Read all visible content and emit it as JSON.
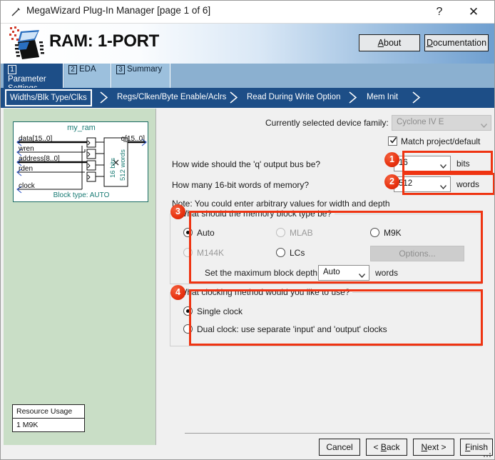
{
  "window": {
    "title": "MegaWizard Plug-In Manager [page 1 of 6]",
    "icon": "wand-icon",
    "help_label": "?",
    "close_label": "✕"
  },
  "banner": {
    "title": "RAM: 1-PORT",
    "logo": "megawizard-chip-icon",
    "buttons": [
      {
        "label": "About",
        "accel": "A",
        "rest": "bout",
        "pre": ""
      },
      {
        "label": "Documentation",
        "accel": "D",
        "rest": "ocumentation",
        "pre": ""
      }
    ]
  },
  "tabs": [
    {
      "num": "1",
      "label": "Parameter Settings",
      "active": true
    },
    {
      "num": "2",
      "label": "EDA",
      "active": false
    },
    {
      "num": "3",
      "label": "Summary",
      "active": false
    }
  ],
  "breadcrumbs": [
    {
      "label": "Widths/Blk Type/Clks",
      "active": true
    },
    {
      "label": "Regs/Clken/Byte Enable/Aclrs",
      "active": false
    },
    {
      "label": "Read During Write Option",
      "active": false
    },
    {
      "label": "Mem Init",
      "active": false
    }
  ],
  "preview": {
    "module_name": "my_ram",
    "inputs": [
      "data[15..0]",
      "wren",
      "address[8..0]",
      "rden",
      "clock"
    ],
    "output": "q[15..0]",
    "core_width": "16 bits",
    "core_depth": "512 words",
    "core_sep": "×",
    "block_type": "Block type: AUTO",
    "resource_title": "Resource Usage",
    "resource_value": "1 M9K"
  },
  "form": {
    "device_family_label": "Currently selected device family:",
    "device_family_value": "Cyclone IV E",
    "match_default_label": "Match project/default",
    "match_default_checked": true,
    "width_question": "How wide should the 'q' output bus be?",
    "width_value": "16",
    "width_units": "bits",
    "depth_question": "How many 16-bit words of memory?",
    "depth_value": "512",
    "depth_units": "words",
    "note": "Note: You could enter arbitrary values for width and depth"
  },
  "block_type_group": {
    "legend": "What should the memory block type be?",
    "options": [
      {
        "label": "Auto",
        "selected": true,
        "disabled": false
      },
      {
        "label": "MLAB",
        "selected": false,
        "disabled": true
      },
      {
        "label": "M9K",
        "selected": false,
        "disabled": false
      },
      {
        "label": "M144K",
        "selected": false,
        "disabled": true
      },
      {
        "label": "LCs",
        "selected": false,
        "disabled": false
      }
    ],
    "options_button": "Options...",
    "depth_label": "Set the maximum block depth to",
    "depth_value": "Auto",
    "depth_units": "words"
  },
  "clocking_group": {
    "legend": "What clocking method would you like to use?",
    "options": [
      {
        "label": "Single clock",
        "selected": true
      },
      {
        "label": "Dual clock: use separate 'input' and 'output' clocks",
        "selected": false
      }
    ]
  },
  "annotations": [
    {
      "number": "1"
    },
    {
      "number": "2"
    },
    {
      "number": "3"
    },
    {
      "number": "4"
    }
  ],
  "footer": {
    "buttons": [
      {
        "label": "Cancel",
        "pre": "Cancel",
        "accel": "",
        "rest": ""
      },
      {
        "label": "< Back",
        "pre": "< ",
        "accel": "B",
        "rest": "ack"
      },
      {
        "label": "Next >",
        "pre": "",
        "accel": "N",
        "rest": "ext >"
      },
      {
        "label": "Finish",
        "pre": "",
        "accel": "F",
        "rest": "inish"
      }
    ]
  },
  "colors": {
    "accent_blue": "#1d4e87",
    "annotation_red": "#ef3412",
    "preview_green": "#c9dec6",
    "diagram_teal": "#177a73"
  }
}
